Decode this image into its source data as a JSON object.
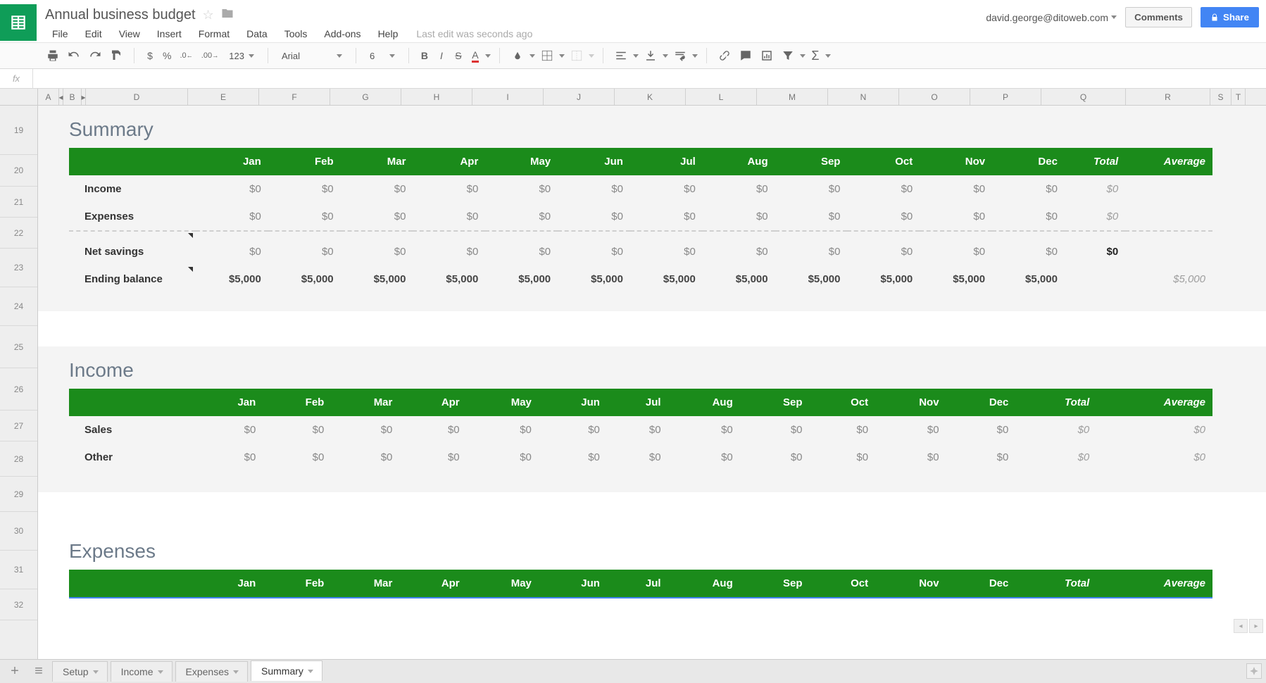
{
  "user": {
    "email": "david.george@ditoweb.com"
  },
  "doc": {
    "title": "Annual business budget",
    "last_edit": "Last edit was seconds ago"
  },
  "menu": {
    "file": "File",
    "edit": "Edit",
    "view": "View",
    "insert": "Insert",
    "format": "Format",
    "data": "Data",
    "tools": "Tools",
    "addons": "Add-ons",
    "help": "Help"
  },
  "header_buttons": {
    "comments": "Comments",
    "share": "Share"
  },
  "toolbar": {
    "font_name": "Arial",
    "font_size": "6",
    "number_format": "123",
    "currency": "$",
    "percent": "%",
    "dec_less": ".0",
    "dec_more": ".00",
    "bold": "B",
    "italic": "I",
    "strike": "S",
    "textcolor": "A",
    "sigma": "Σ"
  },
  "columns": [
    "A",
    "B",
    "D",
    "E",
    "F",
    "G",
    "H",
    "I",
    "J",
    "K",
    "L",
    "M",
    "N",
    "O",
    "P",
    "Q",
    "R",
    "S",
    "T"
  ],
  "rows": [
    "19",
    "20",
    "21",
    "22",
    "23",
    "24",
    "25",
    "26",
    "27",
    "28",
    "29",
    "30",
    "31",
    "32"
  ],
  "months": [
    "Jan",
    "Feb",
    "Mar",
    "Apr",
    "May",
    "Jun",
    "Jul",
    "Aug",
    "Sep",
    "Oct",
    "Nov",
    "Dec"
  ],
  "labels": {
    "total": "Total",
    "average": "Average"
  },
  "sections": {
    "summary": {
      "title": "Summary",
      "rows": {
        "income": {
          "label": "Income",
          "values": [
            "$0",
            "$0",
            "$0",
            "$0",
            "$0",
            "$0",
            "$0",
            "$0",
            "$0",
            "$0",
            "$0",
            "$0"
          ],
          "total": "$0",
          "average": ""
        },
        "expenses": {
          "label": "Expenses",
          "values": [
            "$0",
            "$0",
            "$0",
            "$0",
            "$0",
            "$0",
            "$0",
            "$0",
            "$0",
            "$0",
            "$0",
            "$0"
          ],
          "total": "$0",
          "average": ""
        },
        "net": {
          "label": "Net savings",
          "values": [
            "$0",
            "$0",
            "$0",
            "$0",
            "$0",
            "$0",
            "$0",
            "$0",
            "$0",
            "$0",
            "$0",
            "$0"
          ],
          "total": "$0",
          "average": ""
        },
        "ending": {
          "label": "Ending balance",
          "values": [
            "$5,000",
            "$5,000",
            "$5,000",
            "$5,000",
            "$5,000",
            "$5,000",
            "$5,000",
            "$5,000",
            "$5,000",
            "$5,000",
            "$5,000",
            "$5,000"
          ],
          "total": "",
          "average": "$5,000"
        }
      }
    },
    "income": {
      "title": "Income",
      "rows": {
        "sales": {
          "label": "Sales",
          "values": [
            "$0",
            "$0",
            "$0",
            "$0",
            "$0",
            "$0",
            "$0",
            "$0",
            "$0",
            "$0",
            "$0",
            "$0"
          ],
          "total": "$0",
          "average": "$0"
        },
        "other": {
          "label": "Other",
          "values": [
            "$0",
            "$0",
            "$0",
            "$0",
            "$0",
            "$0",
            "$0",
            "$0",
            "$0",
            "$0",
            "$0",
            "$0"
          ],
          "total": "$0",
          "average": "$0"
        }
      }
    },
    "expenses": {
      "title": "Expenses"
    }
  },
  "tabs": {
    "setup": "Setup",
    "income": "Income",
    "expenses": "Expenses",
    "summary": "Summary",
    "active": "Summary"
  }
}
